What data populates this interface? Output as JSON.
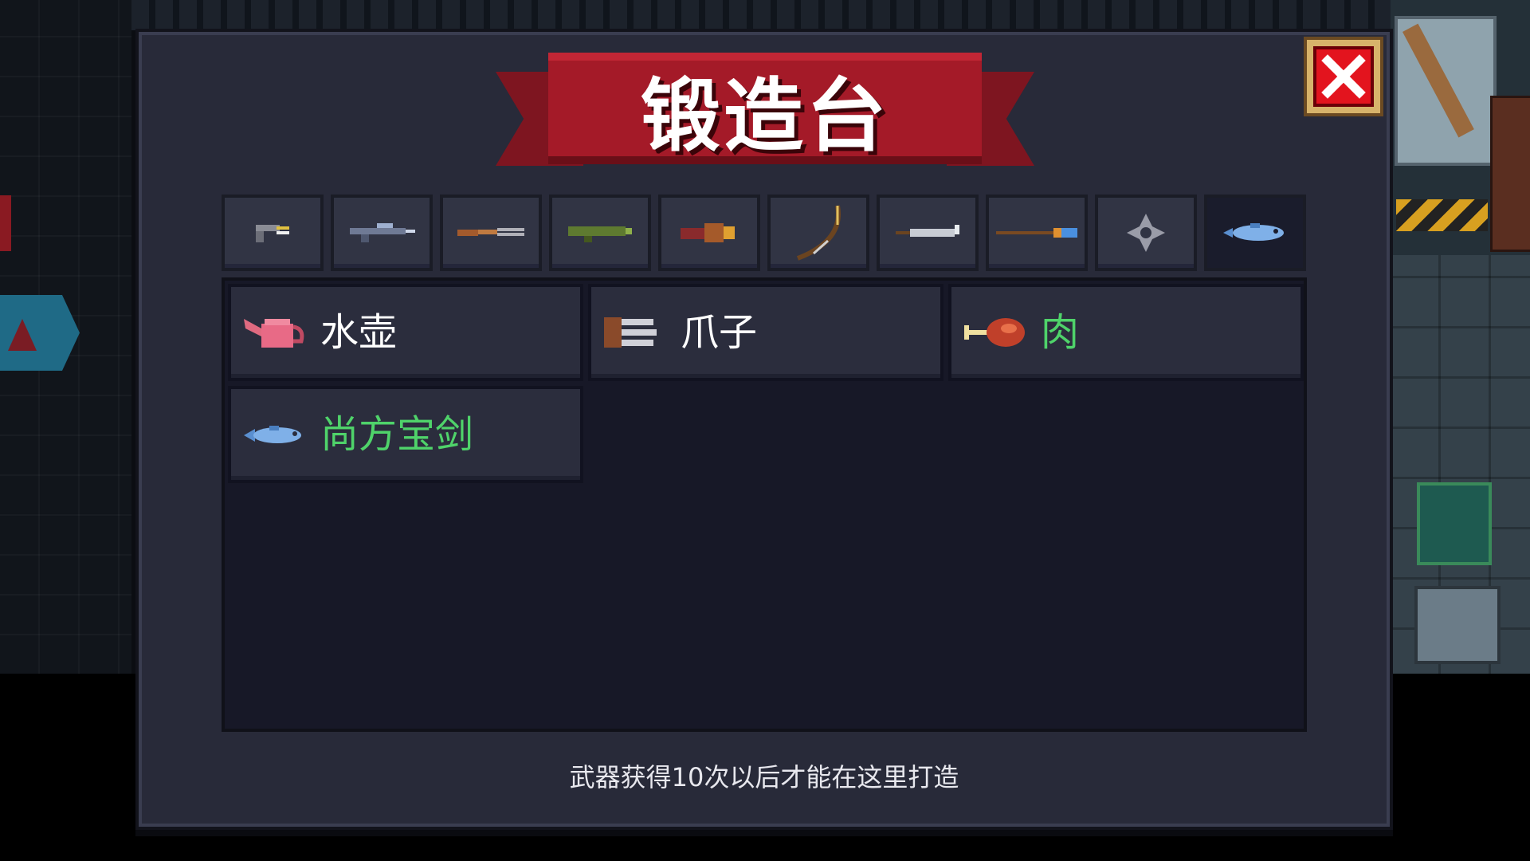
{
  "dialog": {
    "title": "锻造台",
    "close_icon": "close-x-icon",
    "hint": "武器获得10次以后才能在这里打造"
  },
  "tabs": [
    {
      "icon": "pistol-icon"
    },
    {
      "icon": "rifle-icon"
    },
    {
      "icon": "shotgun-icon"
    },
    {
      "icon": "launcher-icon"
    },
    {
      "icon": "heavy-gun-icon"
    },
    {
      "icon": "bow-icon"
    },
    {
      "icon": "blade-icon"
    },
    {
      "icon": "spear-icon"
    },
    {
      "icon": "shuriken-icon"
    },
    {
      "icon": "fish-icon",
      "active": true
    }
  ],
  "items": [
    {
      "label": "水壶",
      "icon": "watering-can-icon",
      "label_color": "#ffffff"
    },
    {
      "label": "爪子",
      "icon": "claw-icon",
      "label_color": "#ffffff"
    },
    {
      "label": "肉",
      "icon": "meat-icon",
      "label_color": "#4fd36a"
    },
    {
      "label": "尚方宝剑",
      "icon": "fish-sword-icon",
      "label_color": "#4fd36a"
    }
  ],
  "colors": {
    "ribbon": "#a41a28",
    "panel": "#282a39",
    "highlight_text": "#4fd36a",
    "close_button": "#e3141e"
  }
}
